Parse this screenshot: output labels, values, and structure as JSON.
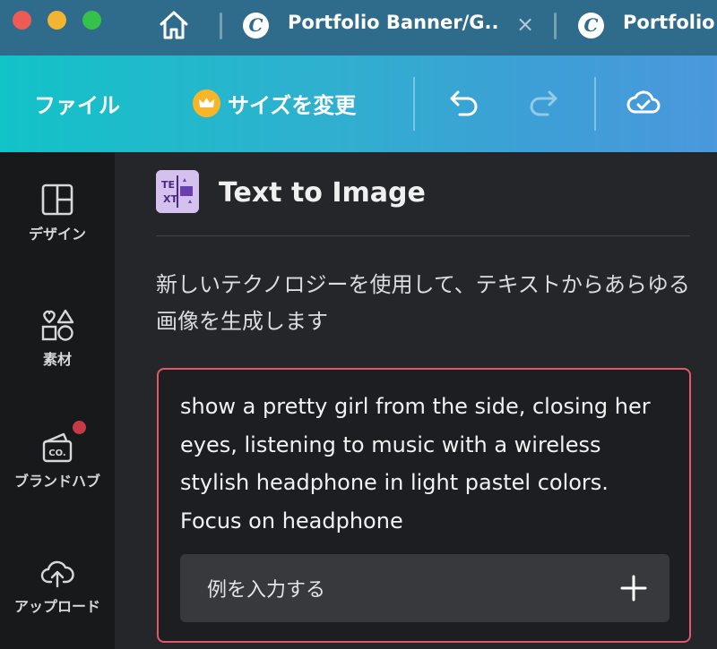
{
  "browser": {
    "tabs": [
      {
        "title": "Portfolio Banner/G...",
        "closable": true
      },
      {
        "title": "Portfolio"
      }
    ],
    "close_glyph": "×",
    "logo_glyph": "C",
    "icons": [
      "home-icon",
      "canva-logo-icon",
      "close-icon"
    ]
  },
  "toolbar": {
    "file_label": "ファイル",
    "resize_label": "サイズを変更",
    "icons": [
      "crown-icon",
      "undo-icon",
      "redo-icon",
      "cloud-saved-icon"
    ]
  },
  "sidebar": {
    "items": [
      {
        "label": "デザイン",
        "icon": "layout-icon"
      },
      {
        "label": "素材",
        "icon": "shapes-icon"
      },
      {
        "label": "ブランドハブ",
        "icon": "brand-kit-icon",
        "has_notification": true
      },
      {
        "label": "アップロード",
        "icon": "upload-cloud-icon"
      }
    ]
  },
  "panel": {
    "app_title": "Text to Image",
    "app_icon": "text-to-image-icon",
    "description": "新しいテクノロジーを使用して、テキストからあらゆる画像を生成します",
    "prompt": "show a pretty girl from the side, closing her eyes, listening to music with  a wireless stylish headphone in light pastel colors. Focus on headphone",
    "example_button": "例を入力する"
  },
  "colors": {
    "accent_border": "#e0586a",
    "toolbar_start": "#12c3c8",
    "toolbar_end": "#4b98dc",
    "notification": "#c63a46"
  }
}
